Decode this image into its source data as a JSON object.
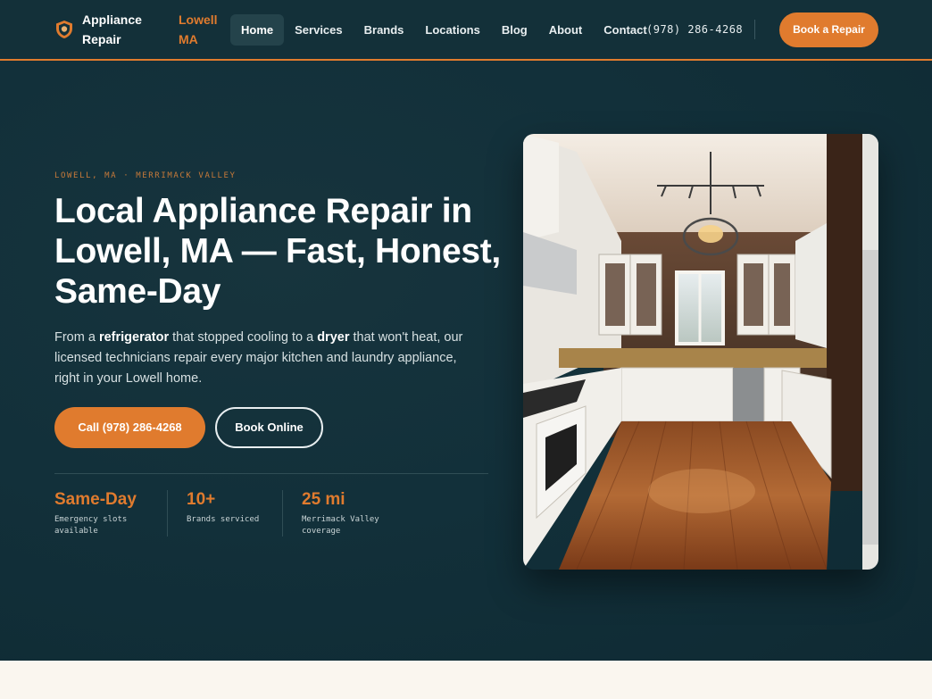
{
  "nav": {
    "brand": "Appliance Repair",
    "city": "Lowell MA",
    "links": [
      "Home",
      "Services",
      "Brands",
      "Locations",
      "Blog",
      "About",
      "Contact"
    ],
    "active": "Home",
    "phone": "(978) 286-4268",
    "book_label": "Book a Repair"
  },
  "hero": {
    "eyebrow": "LOWELL, MA · MERRIMACK VALLEY",
    "title": "Local Appliance Repair in Lowell, MA — Fast, Honest, Same-Day",
    "desc": {
      "p1": "From a ",
      "b1": "refrigerator",
      "p2": " that stopped cooling to a ",
      "b2": "dryer",
      "p3": " that won't heat, our licensed technicians repair every major kitchen and laundry appliance, right in your Lowell home."
    },
    "call_label": "Call (978) 286-4268",
    "book_label": "Book Online",
    "stats": [
      {
        "value": "Same-Day",
        "label": "Emergency slots available"
      },
      {
        "value": "10+",
        "label": "Brands serviced"
      },
      {
        "value": "25 mi",
        "label": "Merrimack Valley coverage"
      }
    ]
  },
  "colors": {
    "accent": "#e07b2e",
    "navy": "#12303a",
    "cream": "#faf6ef"
  },
  "icons": {
    "logo": "shield-icon"
  }
}
